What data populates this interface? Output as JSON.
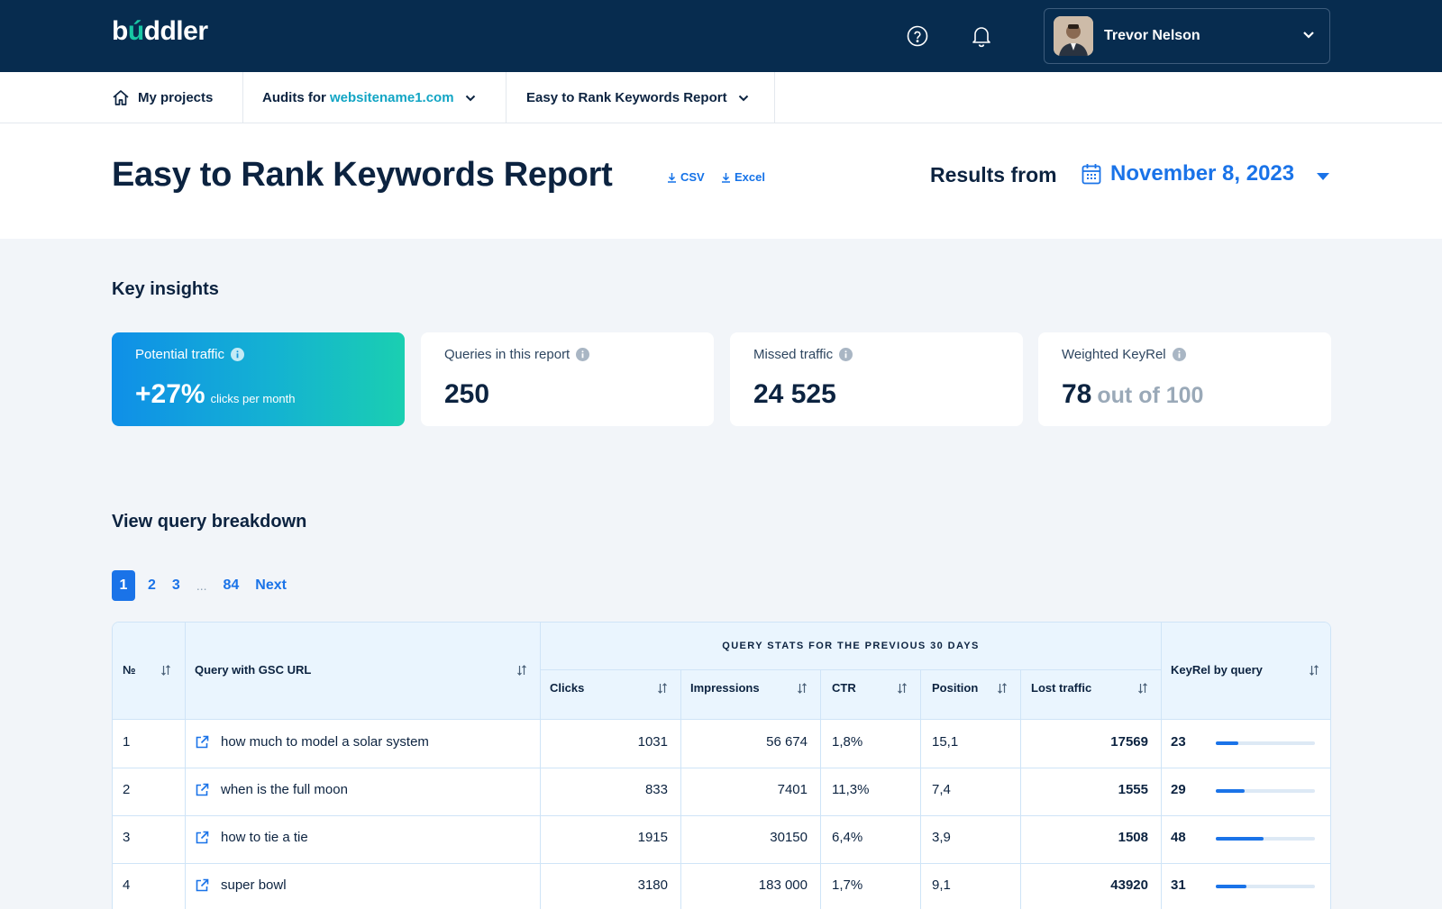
{
  "app": {
    "logo_text_pre": "b",
    "logo_text_dot": "ú",
    "logo_text_post": "ddler"
  },
  "header_bar": {
    "user_name": "Trevor Nelson",
    "icons": [
      "help-circle-icon",
      "bell-icon",
      "chevron-down-icon"
    ]
  },
  "breadcrumb": {
    "home_label": "My projects",
    "audits_prefix": "Audits for ",
    "audits_site": "websitename1.com",
    "report_label": "Easy to Rank Keywords Report"
  },
  "page": {
    "title": "Easy to Rank Keywords Report",
    "csv_label": "CSV",
    "excel_label": "Excel",
    "results_label": "Results from",
    "results_date": "November 8, 2023"
  },
  "insights": {
    "title": "Key insights",
    "cards": [
      {
        "label": "Potential traffic",
        "value": "+27%",
        "suffix": "clicks per month"
      },
      {
        "label": "Queries in this report",
        "value": "250"
      },
      {
        "label": "Missed traffic",
        "value": "24 525"
      },
      {
        "label": "Weighted KeyRel",
        "value": "78",
        "suffix": "out of 100"
      }
    ]
  },
  "breakdown": {
    "title": "View query breakdown",
    "pagination": {
      "pages": [
        "1",
        "2",
        "3"
      ],
      "dots": "...",
      "last": "84",
      "next": "Next",
      "active": "1"
    },
    "columns": {
      "no": "№",
      "query": "Query with GSC URL",
      "group": "QUERY STATS FOR THE PREVIOUS 30 DAYS",
      "clicks": "Clicks",
      "impressions": "Impressions",
      "ctr": "CTR",
      "position": "Position",
      "lost": "Lost traffic",
      "keyrel": "KeyRel by query"
    },
    "rows": [
      {
        "no": "1",
        "query": "how much to model a solar system",
        "clicks": "1031",
        "impressions": "56 674",
        "ctr": "1,8%",
        "position": "15,1",
        "lost": "17569",
        "keyrel": "23",
        "keyrel_fraction": 0.23
      },
      {
        "no": "2",
        "query": "when is the full moon",
        "clicks": "833",
        "impressions": "7401",
        "ctr": "11,3%",
        "position": "7,4",
        "lost": "1555",
        "keyrel": "29",
        "keyrel_fraction": 0.29
      },
      {
        "no": "3",
        "query": "how to tie a tie",
        "clicks": "1915",
        "impressions": "30150",
        "ctr": "6,4%",
        "position": "3,9",
        "lost": "1508",
        "keyrel": "48",
        "keyrel_fraction": 0.48
      },
      {
        "no": "4",
        "query": "super bowl",
        "clicks": "3180",
        "impressions": "183 000",
        "ctr": "1,7%",
        "position": "9,1",
        "lost": "43920",
        "keyrel": "31",
        "keyrel_fraction": 0.31
      }
    ]
  },
  "colors": {
    "topbar": "#072c4f",
    "accent": "#1a73e8",
    "teal": "#18c6a4"
  }
}
